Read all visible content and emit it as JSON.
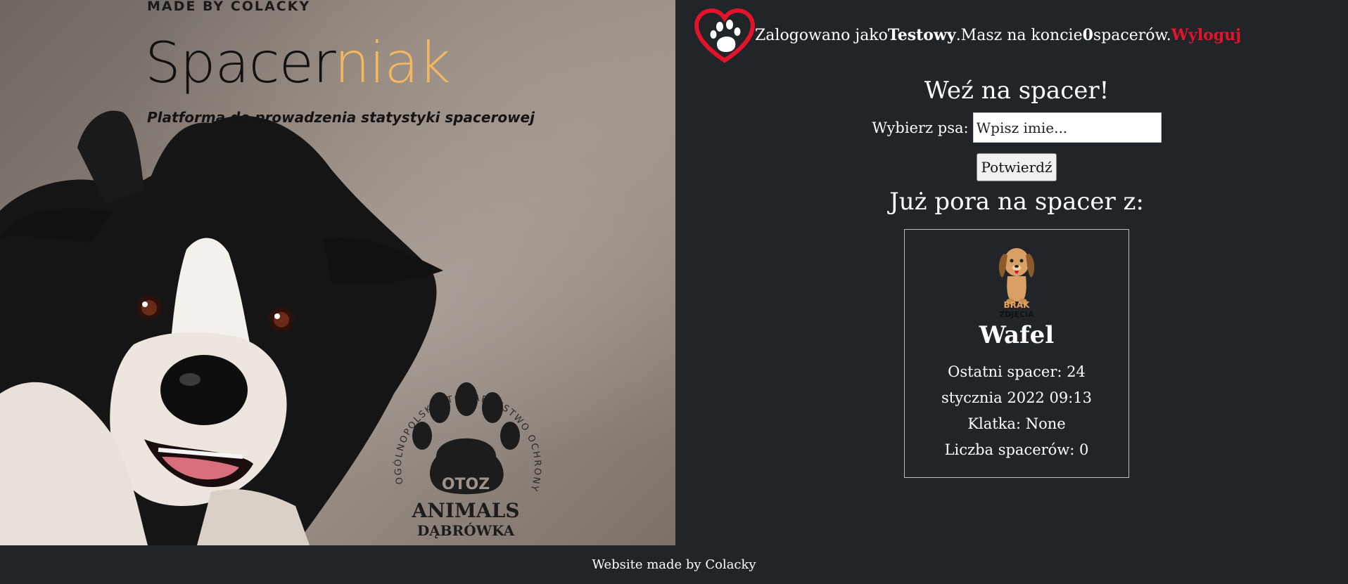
{
  "hero": {
    "made_by": "MADE BY COLACKY",
    "brand_part_a": "Spacer",
    "brand_part_b": "niak",
    "tagline": "Platforma do prowadzenia statystyki spacerowej",
    "badge_arc_text": "OGÓLNOPOLSKIE TOWARZYSTWO OCHRONY ZWIERZĄT",
    "badge_otoz": "OTOZ",
    "badge_animals": "ANIMALS",
    "badge_city": "DĄBRÓWKA"
  },
  "topbar": {
    "logged_prefix": "Zalogowano jako ",
    "username": "Testowy",
    "balance_prefix": ".Masz na koncie ",
    "walk_count": "0",
    "balance_suffix": " spacerów.",
    "logout_label": "Wyloguj",
    "logo_icon": "heart-paw-icon"
  },
  "walk_form": {
    "title": "Weź na spacer!",
    "select_label": "Wybierz psa: ",
    "input_placeholder": "Wpisz imie...",
    "input_value": "",
    "submit_label": "Potwierdź"
  },
  "due_section": {
    "title": "Już pora na spacer z:",
    "dogs": [
      {
        "photo_label_line1": "BRAK",
        "photo_label_line2": "ZDJĘCIA",
        "name": "Wafel",
        "last_walk": "Ostatni spacer: 24 stycznia 2022 09:13",
        "cage": "Klatka: None",
        "walk_count": "Liczba spacerów: 0"
      }
    ]
  },
  "footer": {
    "text": "Website made by Colacky"
  },
  "colors": {
    "background": "#212529",
    "brand_accent": "#f3b760",
    "logout": "#e2142a",
    "heart": "#e2142a"
  }
}
